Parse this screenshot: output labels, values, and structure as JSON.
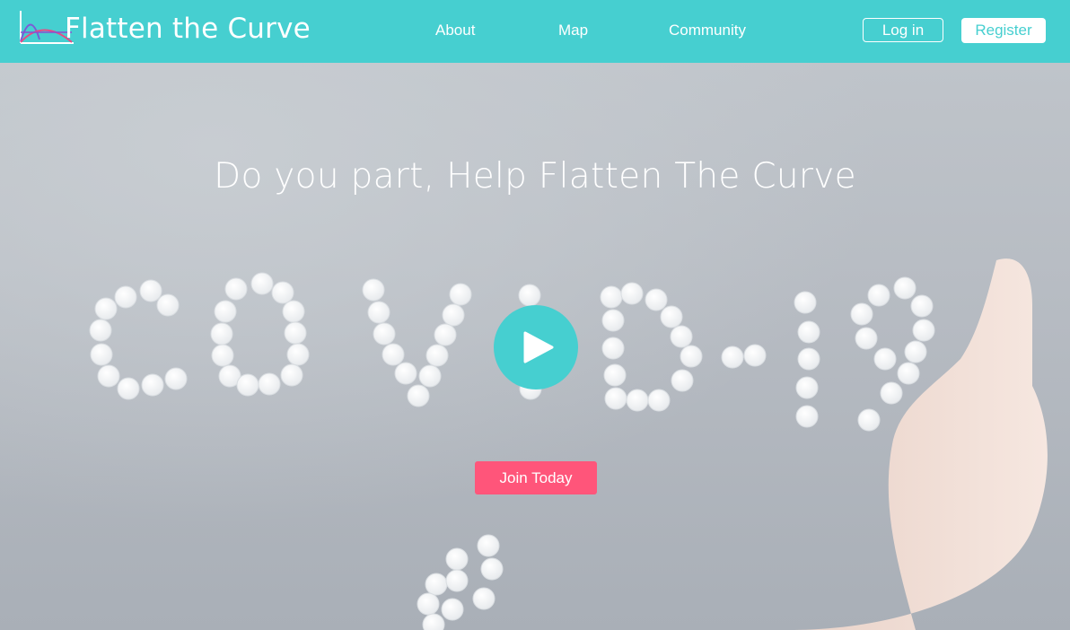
{
  "brand": {
    "name": "Flatten the Curve",
    "logo_icon": "curve-chart-logo"
  },
  "nav": {
    "links": [
      "About",
      "Map",
      "Community"
    ]
  },
  "auth": {
    "login_label": "Log in",
    "register_label": "Register"
  },
  "hero": {
    "headline": "Do you part, Help Flatten The Curve",
    "video_text": "covid-19",
    "play_icon": "play-icon",
    "cta_label": "Join Today"
  },
  "colors": {
    "brand_teal": "#46cfd0",
    "cta_pink": "#ff557a",
    "text_white": "#ffffff"
  }
}
